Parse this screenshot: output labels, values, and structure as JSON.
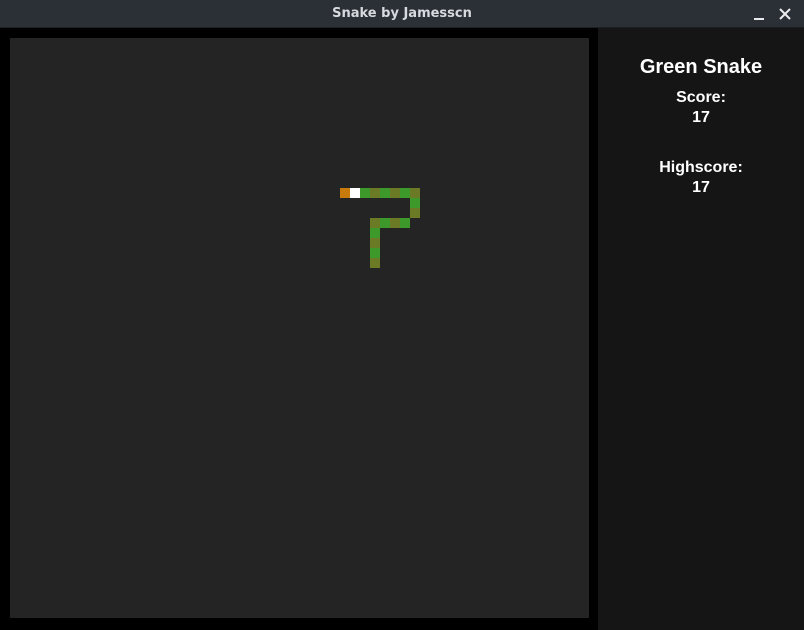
{
  "window": {
    "title": "Snake by Jamesscn"
  },
  "sidebar": {
    "player_name": "Green Snake",
    "score_label": "Score:",
    "score_value": "17",
    "highscore_label": "Highscore:",
    "highscore_value": "17"
  },
  "game": {
    "grid_cols": 58,
    "grid_rows": 58,
    "food": {
      "col": 33,
      "row": 15,
      "color": "#c97a0d"
    },
    "snake_head": {
      "col": 34,
      "row": 15,
      "color": "#ffffff"
    },
    "snake_body": [
      {
        "col": 35,
        "row": 15
      },
      {
        "col": 36,
        "row": 15
      },
      {
        "col": 37,
        "row": 15
      },
      {
        "col": 38,
        "row": 15
      },
      {
        "col": 39,
        "row": 15
      },
      {
        "col": 40,
        "row": 15
      },
      {
        "col": 40,
        "row": 16
      },
      {
        "col": 40,
        "row": 17
      },
      {
        "col": 39,
        "row": 18
      },
      {
        "col": 38,
        "row": 18
      },
      {
        "col": 37,
        "row": 18
      },
      {
        "col": 36,
        "row": 18
      },
      {
        "col": 36,
        "row": 19
      },
      {
        "col": 36,
        "row": 20
      },
      {
        "col": 36,
        "row": 21
      },
      {
        "col": 36,
        "row": 22
      }
    ],
    "body_colors": [
      "#3d9a2a",
      "#6b7a25"
    ],
    "board_color": "#242424"
  }
}
